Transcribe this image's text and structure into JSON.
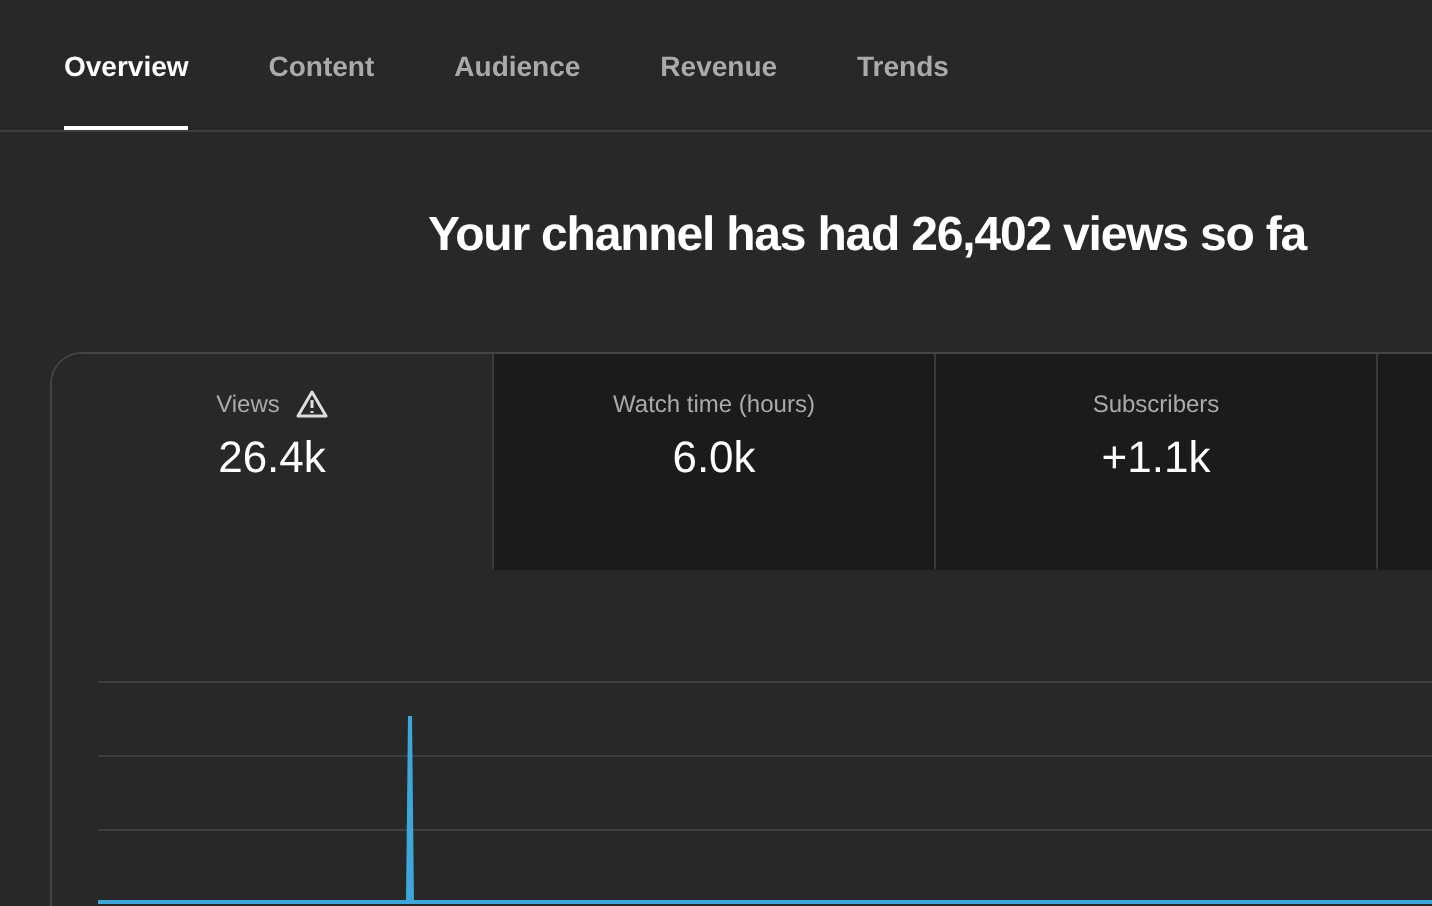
{
  "tabs": [
    {
      "label": "Overview",
      "selected": true
    },
    {
      "label": "Content",
      "selected": false
    },
    {
      "label": "Audience",
      "selected": false
    },
    {
      "label": "Revenue",
      "selected": false
    },
    {
      "label": "Trends",
      "selected": false
    }
  ],
  "heading": "Your channel has had 26,402 views so fa",
  "metrics": [
    {
      "label": "Views",
      "value": "26.4k",
      "selected": true,
      "warning": true
    },
    {
      "label": "Watch time (hours)",
      "value": "6.0k",
      "selected": false,
      "warning": false
    },
    {
      "label": "Subscribers",
      "value": "+1.1k",
      "selected": false,
      "warning": false
    }
  ]
}
